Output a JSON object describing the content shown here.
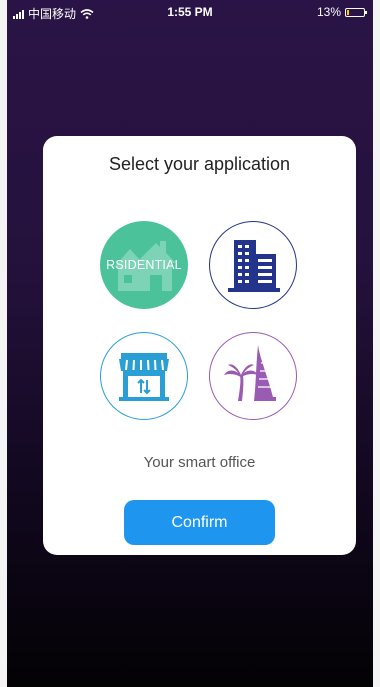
{
  "status_bar": {
    "carrier": "中国移动",
    "time": "1:55 PM",
    "battery_percent": "13%",
    "battery_level": 0.13,
    "icons": [
      "signal-icon",
      "wifi-icon",
      "battery-icon"
    ]
  },
  "dialog": {
    "title": "Select your application",
    "options": [
      {
        "id": "residential",
        "label": "RSIDENTIAL",
        "icon": "house-icon",
        "color": "#4cc29a",
        "selected": true
      },
      {
        "id": "office",
        "label": "",
        "icon": "office-building-icon",
        "color": "#22348b",
        "selected": false
      },
      {
        "id": "store",
        "label": "",
        "icon": "storefront-icon",
        "color": "#2a9fd6",
        "selected": false
      },
      {
        "id": "hotel",
        "label": "",
        "icon": "hotel-palm-icon",
        "color": "#9a5bb3",
        "selected": false
      }
    ],
    "description": "Your smart office",
    "confirm_label": "Confirm"
  },
  "colors": {
    "background_top": "#2a1447",
    "background_bottom": "#030204",
    "accent": "#1e96f0",
    "residential": "#4cc29a",
    "office": "#22348b",
    "store": "#2a9fd6",
    "hotel": "#9a5bb3"
  }
}
